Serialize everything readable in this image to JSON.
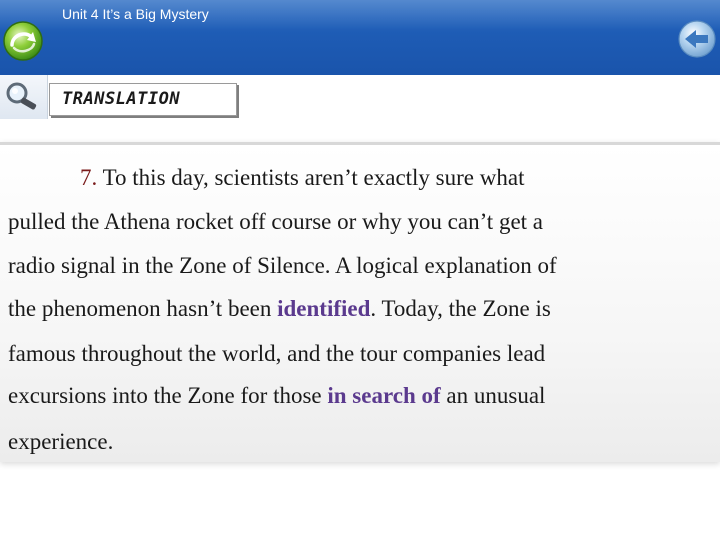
{
  "header": {
    "unit_title": "Unit 4 It’s a Big Mystery"
  },
  "section": {
    "label": "TRANSLATION"
  },
  "passage": {
    "item_number": "7.",
    "lines": [
      {
        "text": "To this day, scientists aren’t exactly sure what"
      },
      {
        "text": "pulled the Athena rocket off course or why you can’t get a"
      },
      {
        "text": "radio signal in the Zone of Silence. A logical explanation of"
      },
      {
        "pre": "the phenomenon hasn’t been ",
        "answer": "identified",
        "post": ". Today, the Zone is"
      },
      {
        "text": "famous throughout the world, and the tour companies lead"
      },
      {
        "pre": "excursions into the Zone for those ",
        "answer": "in search of",
        "post": " an unusual"
      },
      {
        "text": "experience."
      }
    ]
  },
  "colors": {
    "header_blue": "#1e5cb5",
    "answer_purple": "#5b3a8e",
    "item_number_red": "#7a1b1b"
  },
  "icons": {
    "home": "swirl-arrow-icon",
    "back": "back-arrow-icon",
    "search": "magnifier-icon"
  }
}
